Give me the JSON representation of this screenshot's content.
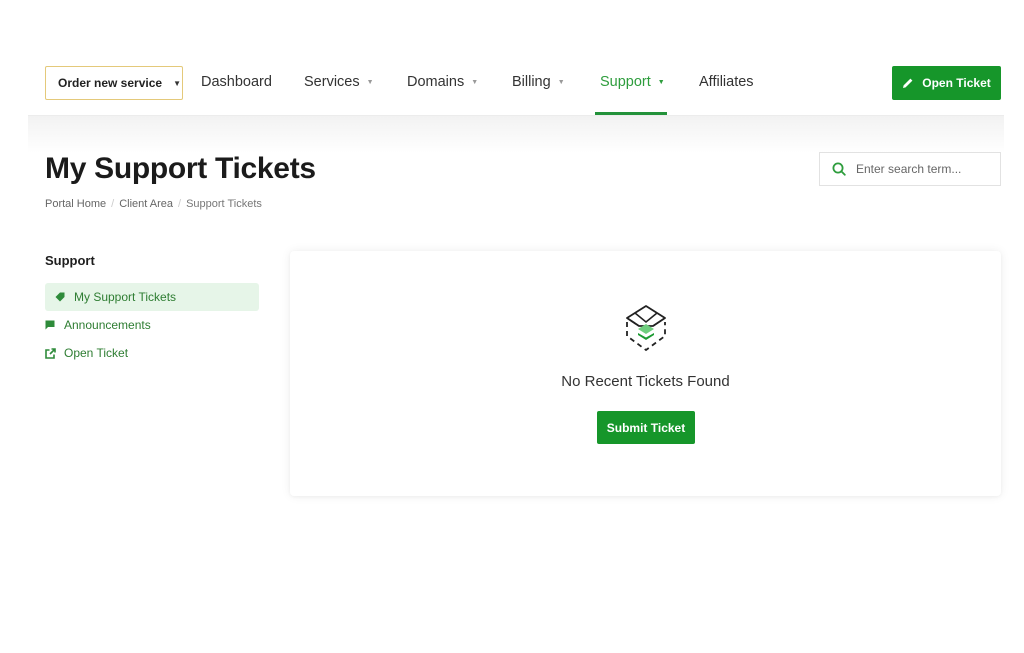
{
  "header": {
    "order_button": {
      "label": "Order new service",
      "icon": "caret-down-icon"
    },
    "nav": [
      {
        "label": "Dashboard",
        "has_dropdown": false,
        "active": false
      },
      {
        "label": "Services",
        "has_dropdown": true,
        "active": false
      },
      {
        "label": "Domains",
        "has_dropdown": true,
        "active": false
      },
      {
        "label": "Billing",
        "has_dropdown": true,
        "active": false
      },
      {
        "label": "Support",
        "has_dropdown": true,
        "active": true
      },
      {
        "label": "Affiliates",
        "has_dropdown": false,
        "active": false
      }
    ],
    "open_ticket_button": {
      "label": "Open Ticket",
      "icon": "pencil-icon"
    }
  },
  "page": {
    "title": "My Support Tickets",
    "breadcrumb": [
      "Portal Home",
      "Client Area",
      "Support Tickets"
    ]
  },
  "search": {
    "placeholder": "Enter search term...",
    "value": "",
    "icon": "search-icon"
  },
  "sidebar": {
    "heading": "Support",
    "items": [
      {
        "label": "My Support Tickets",
        "icon": "tag-icon",
        "active": true
      },
      {
        "label": "Announcements",
        "icon": "flag-icon",
        "active": false
      },
      {
        "label": "Open Ticket",
        "icon": "external-link-icon",
        "active": false
      }
    ]
  },
  "empty_state": {
    "icon": "empty-box-envelope-icon",
    "message": "No Recent Tickets Found",
    "button_label": "Submit Ticket"
  },
  "colors": {
    "accent": "#16962a",
    "nav_active": "#2e9d3d",
    "order_border": "#e4c97a",
    "sidebar_active_bg": "#e6f5e8"
  }
}
